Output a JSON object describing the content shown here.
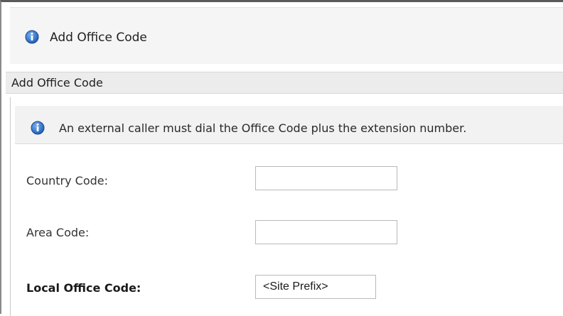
{
  "window": {
    "title": "Add Office Code"
  },
  "section": {
    "title": "Add Office Code"
  },
  "notice": {
    "text": "An external caller must dial the Office Code plus the extension number."
  },
  "form": {
    "country_code": {
      "label": "Country Code:",
      "value": ""
    },
    "area_code": {
      "label": "Area Code:",
      "value": ""
    },
    "local_office_code": {
      "label": "Local Office Code:",
      "value": "<Site Prefix>"
    }
  },
  "icons": {
    "info": "info-icon"
  },
  "colors": {
    "info_icon_fill": "#1f5fb8",
    "bar_background": "#f5f5f5",
    "section_background": "#ececec"
  }
}
